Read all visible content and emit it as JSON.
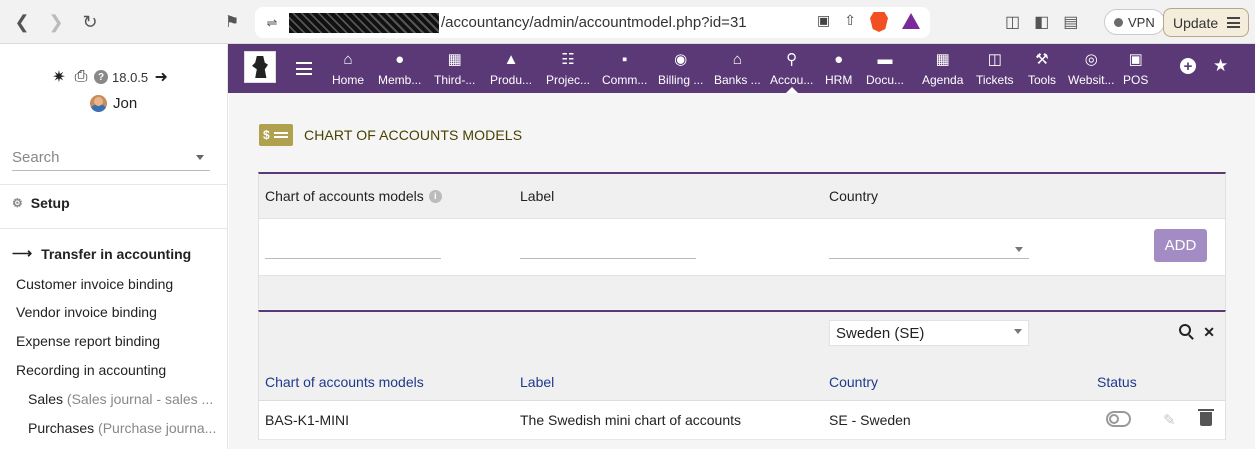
{
  "browser": {
    "url_text": "/accountancy/admin/accountmodel.php?id=31",
    "vpn_label": "VPN",
    "update_label": "Update"
  },
  "sidebar": {
    "version": "18.0.5",
    "help_glyph": "?",
    "user_name": "Jon",
    "search_placeholder": "Search",
    "setup_label": "Setup",
    "transfer_label": "Transfer in accounting",
    "items": [
      {
        "label": "Customer invoice binding"
      },
      {
        "label": "Vendor invoice binding"
      },
      {
        "label": "Expense report binding"
      },
      {
        "label": "Recording in accounting"
      }
    ],
    "subitems": [
      {
        "label": "Sales",
        "detail": "(Sales journal - sales ..."
      },
      {
        "label": "Purchases",
        "detail": "(Purchase journa..."
      }
    ]
  },
  "topmenu": {
    "items": [
      {
        "label": "Home",
        "icon": "home-icon"
      },
      {
        "label": "Memb...",
        "icon": "user-icon"
      },
      {
        "label": "Third-...",
        "icon": "building-icon"
      },
      {
        "label": "Produ...",
        "icon": "cube-icon"
      },
      {
        "label": "Projec...",
        "icon": "sitemap-icon"
      },
      {
        "label": "Comm...",
        "icon": "briefcase-icon"
      },
      {
        "label": "Billing ...",
        "icon": "coins-icon"
      },
      {
        "label": "Banks ...",
        "icon": "bank-icon"
      },
      {
        "label": "Accou...",
        "icon": "search-dollar-icon"
      },
      {
        "label": "HRM",
        "icon": "user-tie-icon"
      },
      {
        "label": "Docu...",
        "icon": "folder-icon"
      },
      {
        "label": "Agenda",
        "icon": "calendar-icon"
      },
      {
        "label": "Tickets",
        "icon": "ticket-icon"
      },
      {
        "label": "Tools",
        "icon": "wrench-icon"
      },
      {
        "label": "Websit...",
        "icon": "globe-icon"
      },
      {
        "label": "POS",
        "icon": "cash-register-icon"
      }
    ]
  },
  "page": {
    "title": "CHART OF ACCOUNTS MODELS",
    "icon_text": "$",
    "form": {
      "col_models": "Chart of accounts models",
      "col_label": "Label",
      "col_country": "Country",
      "add_label": "ADD",
      "info_glyph": "i"
    },
    "list": {
      "filter_country": "Sweden (SE)",
      "col_models": "Chart of accounts models",
      "col_label": "Label",
      "col_country": "Country",
      "col_status": "Status",
      "rows": [
        {
          "model": "BAS-K1-MINI",
          "label": "The Swedish mini chart of accounts",
          "country": "SE - Sweden"
        }
      ]
    }
  }
}
